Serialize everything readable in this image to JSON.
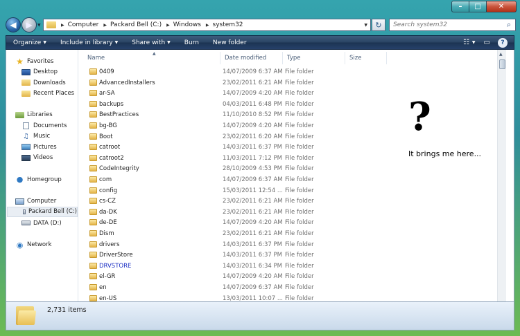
{
  "window": {
    "controls": {
      "minimize": "–",
      "maximize": "□",
      "close": "✕"
    }
  },
  "navigation": {
    "back_glyph": "◀",
    "forward_glyph": "▶"
  },
  "address": {
    "crumbs": [
      "Computer",
      "Packard Bell (C:)",
      "Windows",
      "system32"
    ],
    "refresh_glyph": "↻"
  },
  "search": {
    "placeholder": "Search system32",
    "icon": "search-icon"
  },
  "toolbar": {
    "organize": "Organize",
    "include_in_library": "Include in library",
    "share_with": "Share with",
    "burn": "Burn",
    "new_folder": "New folder",
    "help": "?"
  },
  "sidebar": {
    "favorites": {
      "label": "Favorites",
      "items": [
        "Desktop",
        "Downloads",
        "Recent Places"
      ]
    },
    "libraries": {
      "label": "Libraries",
      "items": [
        "Documents",
        "Music",
        "Pictures",
        "Videos"
      ]
    },
    "homegroup": "Homegroup",
    "computer": {
      "label": "Computer",
      "items": [
        "Packard Bell (C:)",
        "DATA (D:)"
      ]
    },
    "network": "Network"
  },
  "columns": {
    "name": "Name",
    "date_modified": "Date modified",
    "type": "Type",
    "size": "Size"
  },
  "files": [
    {
      "name": "0409",
      "date": "14/07/2009 6:37 AM",
      "type": "File folder"
    },
    {
      "name": "AdvancedInstallers",
      "date": "23/02/2011 6:21 AM",
      "type": "File folder"
    },
    {
      "name": "ar-SA",
      "date": "14/07/2009 4:20 AM",
      "type": "File folder"
    },
    {
      "name": "backups",
      "date": "04/03/2011 6:48 PM",
      "type": "File folder"
    },
    {
      "name": "BestPractices",
      "date": "11/10/2010 8:52 PM",
      "type": "File folder"
    },
    {
      "name": "bg-BG",
      "date": "14/07/2009 4:20 AM",
      "type": "File folder"
    },
    {
      "name": "Boot",
      "date": "23/02/2011 6:20 AM",
      "type": "File folder"
    },
    {
      "name": "catroot",
      "date": "14/03/2011 6:37 PM",
      "type": "File folder"
    },
    {
      "name": "catroot2",
      "date": "11/03/2011 7:12 PM",
      "type": "File folder"
    },
    {
      "name": "CodeIntegrity",
      "date": "28/10/2009 4:53 PM",
      "type": "File folder"
    },
    {
      "name": "com",
      "date": "14/07/2009 6:37 AM",
      "type": "File folder"
    },
    {
      "name": "config",
      "date": "15/03/2011 12:54 ...",
      "type": "File folder"
    },
    {
      "name": "cs-CZ",
      "date": "23/02/2011 6:21 AM",
      "type": "File folder"
    },
    {
      "name": "da-DK",
      "date": "23/02/2011 6:21 AM",
      "type": "File folder"
    },
    {
      "name": "de-DE",
      "date": "14/07/2009 4:20 AM",
      "type": "File folder"
    },
    {
      "name": "Dism",
      "date": "23/02/2011 6:21 AM",
      "type": "File folder"
    },
    {
      "name": "drivers",
      "date": "14/03/2011 6:37 PM",
      "type": "File folder"
    },
    {
      "name": "DriverStore",
      "date": "14/03/2011 6:37 PM",
      "type": "File folder"
    },
    {
      "name": "DRVSTORE",
      "date": "14/03/2011 6:34 PM",
      "type": "File folder",
      "highlight": "#1b2fc4"
    },
    {
      "name": "el-GR",
      "date": "14/07/2009 4:20 AM",
      "type": "File folder"
    },
    {
      "name": "en",
      "date": "14/07/2009 6:37 AM",
      "type": "File folder"
    },
    {
      "name": "en-US",
      "date": "13/03/2011 10:07 ...",
      "type": "File folder"
    }
  ],
  "annotation": {
    "symbol": "?",
    "text": "It brings me here..."
  },
  "details": {
    "item_count": "2,731 items"
  },
  "colors": {
    "command_bar": "#2a4464",
    "compressed_name": "#1b2fc4",
    "frame": "#2f8e9b"
  }
}
